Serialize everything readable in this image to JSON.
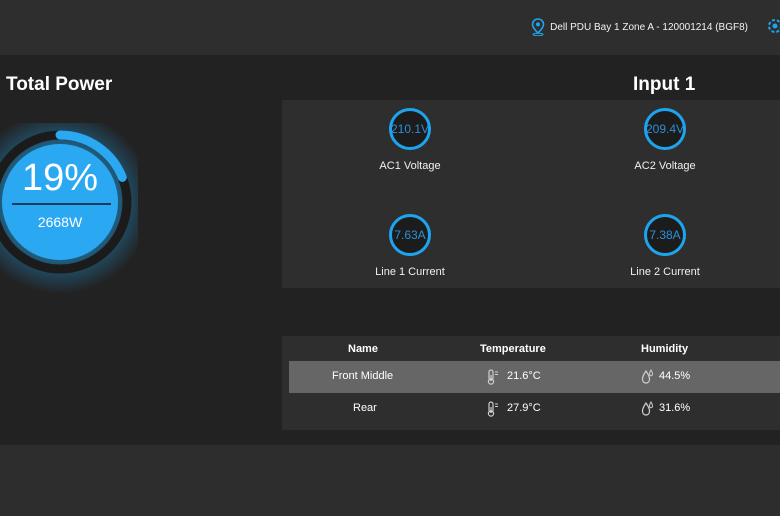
{
  "header": {
    "device_label": "Dell PDU Bay 1 Zone A - 120001214 (BGF8)",
    "truncated_text": "2",
    "icons": [
      "location-pin-icon",
      "settings-gear-icon"
    ]
  },
  "total_power": {
    "title": "Total Power",
    "percent_label": "19%",
    "percent_value": 19,
    "watts": "2668W"
  },
  "input": {
    "title": "Input 1",
    "metrics": [
      {
        "value": "210.1V",
        "label": "AC1 Voltage"
      },
      {
        "value": "209.4V",
        "label": "AC2 Voltage"
      },
      {
        "value": "7.63A",
        "label": "Line 1 Current"
      },
      {
        "value": "7.38A",
        "label": "Line 2 Current"
      }
    ]
  },
  "sensors": {
    "columns": [
      "Name",
      "Temperature",
      "Humidity"
    ],
    "rows": [
      {
        "name": "Front Middle",
        "temperature": "21.6°C",
        "humidity": "44.5%",
        "selected": true
      },
      {
        "name": "Rear",
        "temperature": "27.9°C",
        "humidity": "31.6%",
        "selected": false
      }
    ]
  },
  "colors": {
    "accent": "#1ea4ee",
    "gauge_fill": "#2aa8f2",
    "background": "#222222",
    "panel": "#2e2e2e",
    "selected_row": "#666666"
  }
}
